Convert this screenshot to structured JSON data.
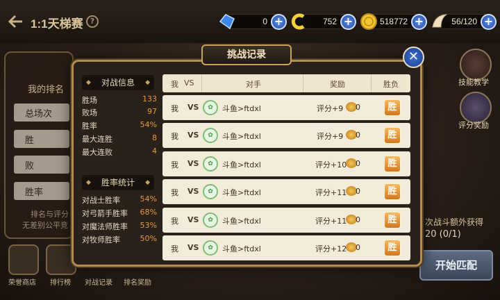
{
  "header": {
    "title": "1:1天梯赛",
    "resources": [
      {
        "name": "diamond",
        "icon": "blue-crystal-icon",
        "value": "0"
      },
      {
        "name": "token",
        "icon": "yellow-c-icon",
        "value": "752"
      },
      {
        "name": "gold",
        "icon": "gold-coin-icon",
        "value": "518772"
      },
      {
        "name": "stamina",
        "icon": "wing-icon",
        "value": "56/120"
      }
    ]
  },
  "background": {
    "my_rank_label": "我的排名",
    "rank_rows": [
      "总场次",
      "胜",
      "败",
      "胜率"
    ],
    "note_1": "排名与评分",
    "note_2": "无差别公平竞",
    "bottom_nav": [
      "荣誉商店",
      "排行榜",
      "对战记录",
      "排名奖励"
    ],
    "side_buttons": [
      "技能教学",
      "评分奖励"
    ],
    "reward_text": "次战斗额外获得",
    "reward_count": "20 (0/1)",
    "match_button": "开始匹配"
  },
  "modal": {
    "title": "挑战记录",
    "battle_info": {
      "header": "对战信息",
      "rows": [
        {
          "label": "胜场",
          "value": "133"
        },
        {
          "label": "败场",
          "value": "97"
        },
        {
          "label": "胜率",
          "value": "54%"
        },
        {
          "label": "最大连胜",
          "value": "8"
        },
        {
          "label": "最大连败",
          "value": "4"
        }
      ]
    },
    "win_rate_stats": {
      "header": "胜率统计",
      "rows": [
        {
          "label": "对战士胜率",
          "value": "54%"
        },
        {
          "label": "对弓箭手胜率",
          "value": "68%"
        },
        {
          "label": "对魔法师胜率",
          "value": "53%"
        },
        {
          "label": "对牧师胜率",
          "value": "50%"
        }
      ]
    },
    "table": {
      "columns": [
        "我",
        "VS",
        "对手",
        "奖励",
        "胜负"
      ],
      "rows": [
        {
          "me": "我",
          "vs": "VS",
          "opponent": "斗鱼>ftdxl",
          "reward": "评分+9",
          "coins": "0",
          "result": "胜"
        },
        {
          "me": "我",
          "vs": "VS",
          "opponent": "斗鱼>ftdxl",
          "reward": "评分+9",
          "coins": "0",
          "result": "胜"
        },
        {
          "me": "我",
          "vs": "VS",
          "opponent": "斗鱼>ftdxl",
          "reward": "评分+10",
          "coins": "0",
          "result": "胜"
        },
        {
          "me": "我",
          "vs": "VS",
          "opponent": "斗鱼>ftdxl",
          "reward": "评分+11",
          "coins": "0",
          "result": "胜"
        },
        {
          "me": "我",
          "vs": "VS",
          "opponent": "斗鱼>ftdxl",
          "reward": "评分+11",
          "coins": "0",
          "result": "胜"
        },
        {
          "me": "我",
          "vs": "VS",
          "opponent": "斗鱼>ftdxl",
          "reward": "评分+12",
          "coins": "0",
          "result": "胜"
        }
      ]
    }
  }
}
